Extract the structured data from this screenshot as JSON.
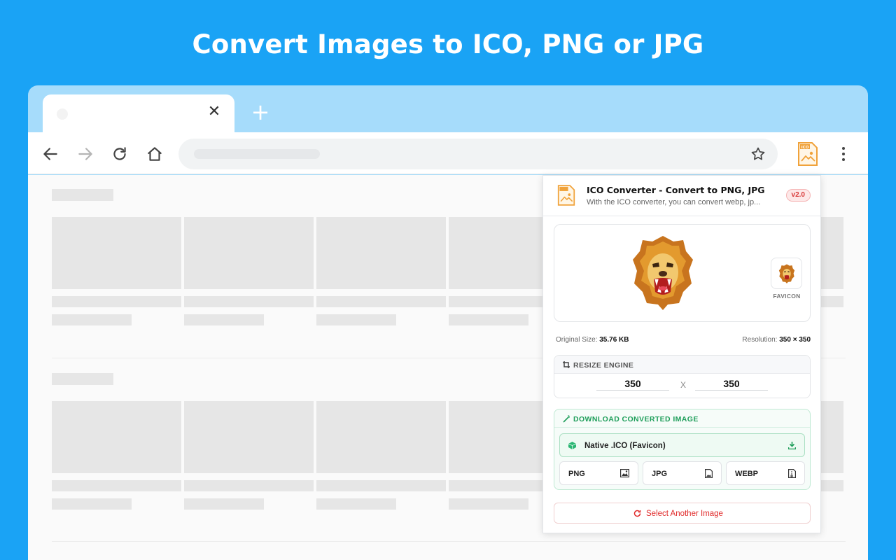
{
  "headline": "Convert Images to ICO, PNG or JPG",
  "browser": {
    "tab_close_glyph": "✕",
    "new_tab_glyph": "+",
    "nav_icons": [
      "back-icon",
      "forward-icon",
      "reload-icon",
      "home-icon"
    ],
    "bookmark_icon": "star-icon",
    "extension_icon": "ico-converter-icon",
    "menu_icon": "more-vert-icon"
  },
  "popup": {
    "title": "ICO Converter - Convert to PNG, JPG",
    "subtitle": "With the ICO converter, you can convert webp, jp...",
    "version": "v2.0",
    "favicon_label": "FAVICON",
    "original_size_label": "Original Size:",
    "original_size_value": "35.76 KB",
    "resolution_label": "Resolution:",
    "resolution_value": "350 × 350",
    "resize": {
      "title": "RESIZE ENGINE",
      "width": "350",
      "height": "350",
      "separator": "X"
    },
    "download": {
      "title": "DOWNLOAD CONVERTED IMAGE",
      "native_label": "Native .ICO (Favicon)",
      "formats": [
        "PNG",
        "JPG",
        "WEBP"
      ]
    },
    "select_another": "Select Another Image"
  },
  "colors": {
    "background": "#1aa3f5",
    "tab_strip": "#a6dcfb",
    "accent_green": "#1e9e5a",
    "accent_red": "#e02a2a",
    "icon_orange": "#f0a23a"
  }
}
